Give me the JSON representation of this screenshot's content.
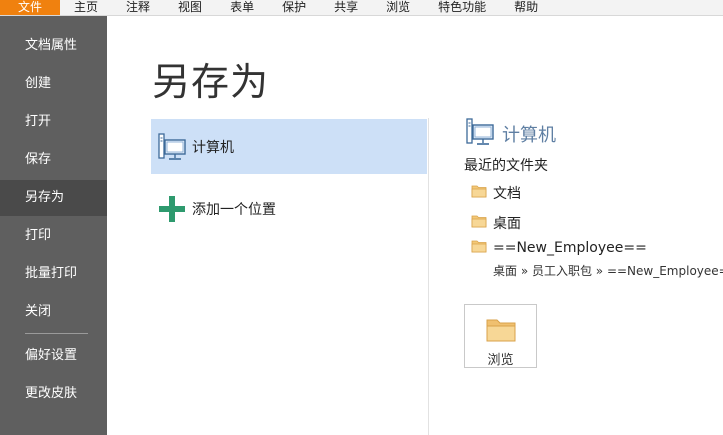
{
  "menu": {
    "items": [
      "文件",
      "主页",
      "注释",
      "视图",
      "表单",
      "保护",
      "共享",
      "浏览",
      "特色功能",
      "帮助"
    ]
  },
  "sidebar": {
    "items": [
      "文档属性",
      "创建",
      "打开",
      "保存",
      "另存为",
      "打印",
      "批量打印",
      "关闭",
      "偏好设置",
      "更改皮肤"
    ],
    "active": "另存为"
  },
  "main": {
    "title": "另存为",
    "locations": [
      {
        "label": "计算机",
        "icon": "computer-icon",
        "selected": true
      },
      {
        "label": "添加一个位置",
        "icon": "plus-icon",
        "selected": false
      }
    ]
  },
  "detail": {
    "title": "计算机",
    "recent_label": "最近的文件夹",
    "folders": [
      {
        "label": "文档"
      },
      {
        "label": "桌面"
      },
      {
        "label": "==New_Employee==",
        "path": "桌面 » 员工入职包 » ==New_Employee==»"
      }
    ],
    "browse_label": "浏览"
  },
  "colors": {
    "accent": "#f0810f",
    "sidebar": "#5f5f5f",
    "sidebar_active": "#4a4a4a",
    "selected": "#cde0f7",
    "detail_title": "#5f7fa3",
    "folder": "#f0c070",
    "plus": "#2e9a6e"
  }
}
